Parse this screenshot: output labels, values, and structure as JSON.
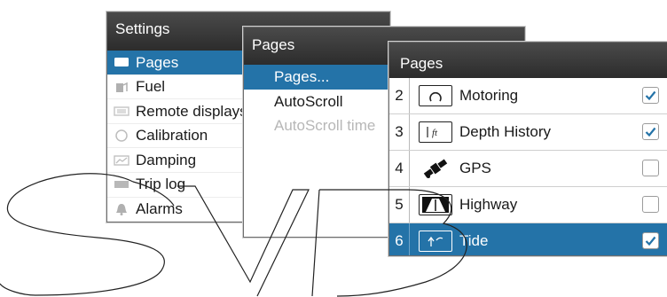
{
  "settings_panel": {
    "title": "Settings",
    "items": [
      {
        "label": "Pages",
        "icon": "pages-icon",
        "selected": true
      },
      {
        "label": "Fuel",
        "icon": "fuel-icon"
      },
      {
        "label": "Remote displays",
        "icon": "remote-displays-icon"
      },
      {
        "label": "Calibration",
        "icon": "calibration-icon"
      },
      {
        "label": "Damping",
        "icon": "damping-icon"
      },
      {
        "label": "Trip log",
        "icon": "trip-log-icon"
      },
      {
        "label": "Alarms",
        "icon": "alarms-icon"
      }
    ]
  },
  "pages_menu": {
    "title": "Pages",
    "items": [
      {
        "label": "Pages...",
        "selected": true
      },
      {
        "label": "AutoScroll"
      },
      {
        "label": "AutoScroll time",
        "disabled": true
      }
    ]
  },
  "pages_list": {
    "title": "Pages",
    "rows": [
      {
        "num": "2",
        "name": "Motoring",
        "icon": "motoring-gauge-icon",
        "checked": true
      },
      {
        "num": "3",
        "name": "Depth History",
        "icon": "depth-history-icon",
        "checked": true
      },
      {
        "num": "4",
        "name": "GPS",
        "icon": "satellite-icon",
        "checked": false
      },
      {
        "num": "5",
        "name": "Highway",
        "icon": "highway-icon",
        "checked": false
      },
      {
        "num": "6",
        "name": "Tide",
        "icon": "tide-icon",
        "checked": true,
        "selected": true
      }
    ]
  },
  "watermark": {
    "text": "SVB"
  },
  "colors": {
    "selection": "#2473a8",
    "titlebar": "#3a3a3a",
    "checkmark": "#2473a8"
  }
}
